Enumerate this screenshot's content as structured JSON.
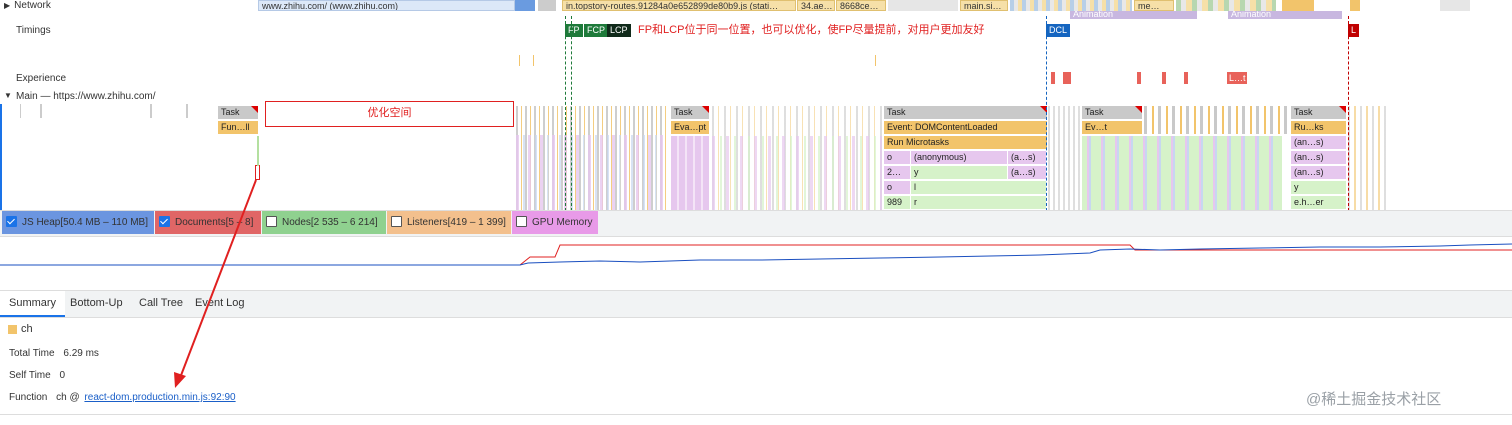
{
  "tracks": {
    "network": "Network",
    "timings": "Timings",
    "experience": "Experience",
    "main": "Main — https://www.zhihu.com/"
  },
  "network_bars": {
    "zhihu": "www.zhihu.com/ (www.zhihu.com)",
    "topstory": "in.topstory-routes.91284a0e652899de80b9.js (stati…",
    "ae": "34.ae…",
    "ce": "8668ce…",
    "main": "main.si…",
    "me": "me…",
    "animation1": "Animation",
    "animation2": "Animation"
  },
  "markers": {
    "fp": "FP",
    "fcp": "FCP",
    "lcp": "LCP",
    "dcl": "DCL",
    "l": "L",
    "note": "FP和LCP位于同一位置，也可以优化，使FP尽量提前，对用户更加友好",
    "exp": "L…t"
  },
  "flame": {
    "task": "Task",
    "fun": "Fun…ll",
    "opt_space": "优化空间",
    "eva": "Eva…pt",
    "dcl_event": "Event: DOMContentLoaded",
    "micro": "Run Microtasks",
    "ev": "Ev…t",
    "ruks": "Ru…ks",
    "an_s": "(an…s)",
    "anonymous": "(anonymous)",
    "a_s": "(a…s)",
    "o": "o",
    "y": "y",
    "l": "l",
    "r": "r",
    "two": "2…",
    "n989": "989",
    "eher": "e.h…er"
  },
  "counters": {
    "js_heap": "JS Heap[50.4 MB – 110 MB]",
    "documents": "Documents[5 – 8]",
    "nodes": "Nodes[2 535 – 6 214]",
    "listeners": "Listeners[419 – 1 399]",
    "gpu": "GPU Memory"
  },
  "tabs": [
    "Summary",
    "Bottom-Up",
    "Call Tree",
    "Event Log"
  ],
  "summary": {
    "name": "ch",
    "total_time_label": "Total Time",
    "total_time_value": "6.29 ms",
    "self_time_label": "Self Time",
    "self_time_value": "0",
    "function_label": "Function",
    "function_value": "ch @",
    "function_link": "react-dom.production.min.js:92:90"
  },
  "watermark": "@稀土掘金技术社区",
  "colors": {
    "accent": "#1a73e8",
    "annotation": "#e02020",
    "task": "#c9c9c9",
    "scripting": "#f2c46b",
    "painting": "#e6c7ee",
    "rendering": "#d6f2c9",
    "fp": "#1e7a3a",
    "dcl": "#1565c0",
    "lcp_l": "#c00000"
  }
}
